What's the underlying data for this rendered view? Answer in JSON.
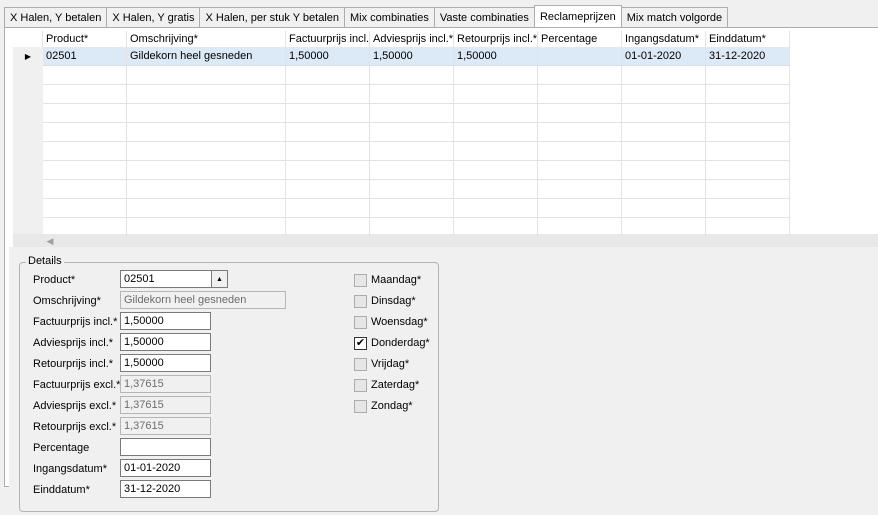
{
  "tabs": [
    {
      "label": "X Halen, Y betalen",
      "active": false
    },
    {
      "label": "X Halen, Y gratis",
      "active": false
    },
    {
      "label": "X Halen, per stuk Y betalen",
      "active": false
    },
    {
      "label": "Mix combinaties",
      "active": false
    },
    {
      "label": "Vaste combinaties",
      "active": false
    },
    {
      "label": "Reclameprijzen",
      "active": true
    },
    {
      "label": "Mix match volgorde",
      "active": false
    }
  ],
  "grid": {
    "columns": [
      "Product*",
      "Omschrijving*",
      "Factuurprijs incl.*",
      "Adviesprijs incl.*",
      "Retourprijs incl.*",
      "Percentage",
      "Ingangsdatum*",
      "Einddatum*"
    ],
    "rows": [
      {
        "current": true,
        "cells": [
          "02501",
          "Gildekorn heel gesneden",
          "1,50000",
          "1,50000",
          "1,50000",
          "",
          "01-01-2020",
          "31-12-2020"
        ]
      }
    ]
  },
  "details": {
    "legend": "Details",
    "fields": [
      {
        "label": "Product*",
        "value": "02501",
        "disabled": false,
        "combo": true
      },
      {
        "label": "Omschrijving*",
        "value": "Gildekorn heel gesneden",
        "disabled": true
      },
      {
        "label": "Factuurprijs incl.*",
        "value": "1,50000",
        "disabled": false
      },
      {
        "label": "Adviesprijs incl.*",
        "value": "1,50000",
        "disabled": false
      },
      {
        "label": "Retourprijs incl.*",
        "value": "1,50000",
        "disabled": false
      },
      {
        "label": "Factuurprijs excl.*",
        "value": "1,37615",
        "disabled": true
      },
      {
        "label": "Adviesprijs excl.*",
        "value": "1,37615",
        "disabled": true
      },
      {
        "label": "Retourprijs excl.*",
        "value": "1,37615",
        "disabled": true
      },
      {
        "label": "Percentage",
        "value": "",
        "disabled": false
      },
      {
        "label": "Ingangsdatum*",
        "value": "01-01-2020",
        "disabled": false
      },
      {
        "label": "Einddatum*",
        "value": "31-12-2020",
        "disabled": false
      }
    ],
    "days": [
      {
        "label": "Maandag*",
        "checked": false
      },
      {
        "label": "Dinsdag*",
        "checked": false
      },
      {
        "label": "Woensdag*",
        "checked": false
      },
      {
        "label": "Donderdag*",
        "checked": true
      },
      {
        "label": "Vrijdag*",
        "checked": false
      },
      {
        "label": "Zaterdag*",
        "checked": false
      },
      {
        "label": "Zondag*",
        "checked": false
      }
    ]
  }
}
